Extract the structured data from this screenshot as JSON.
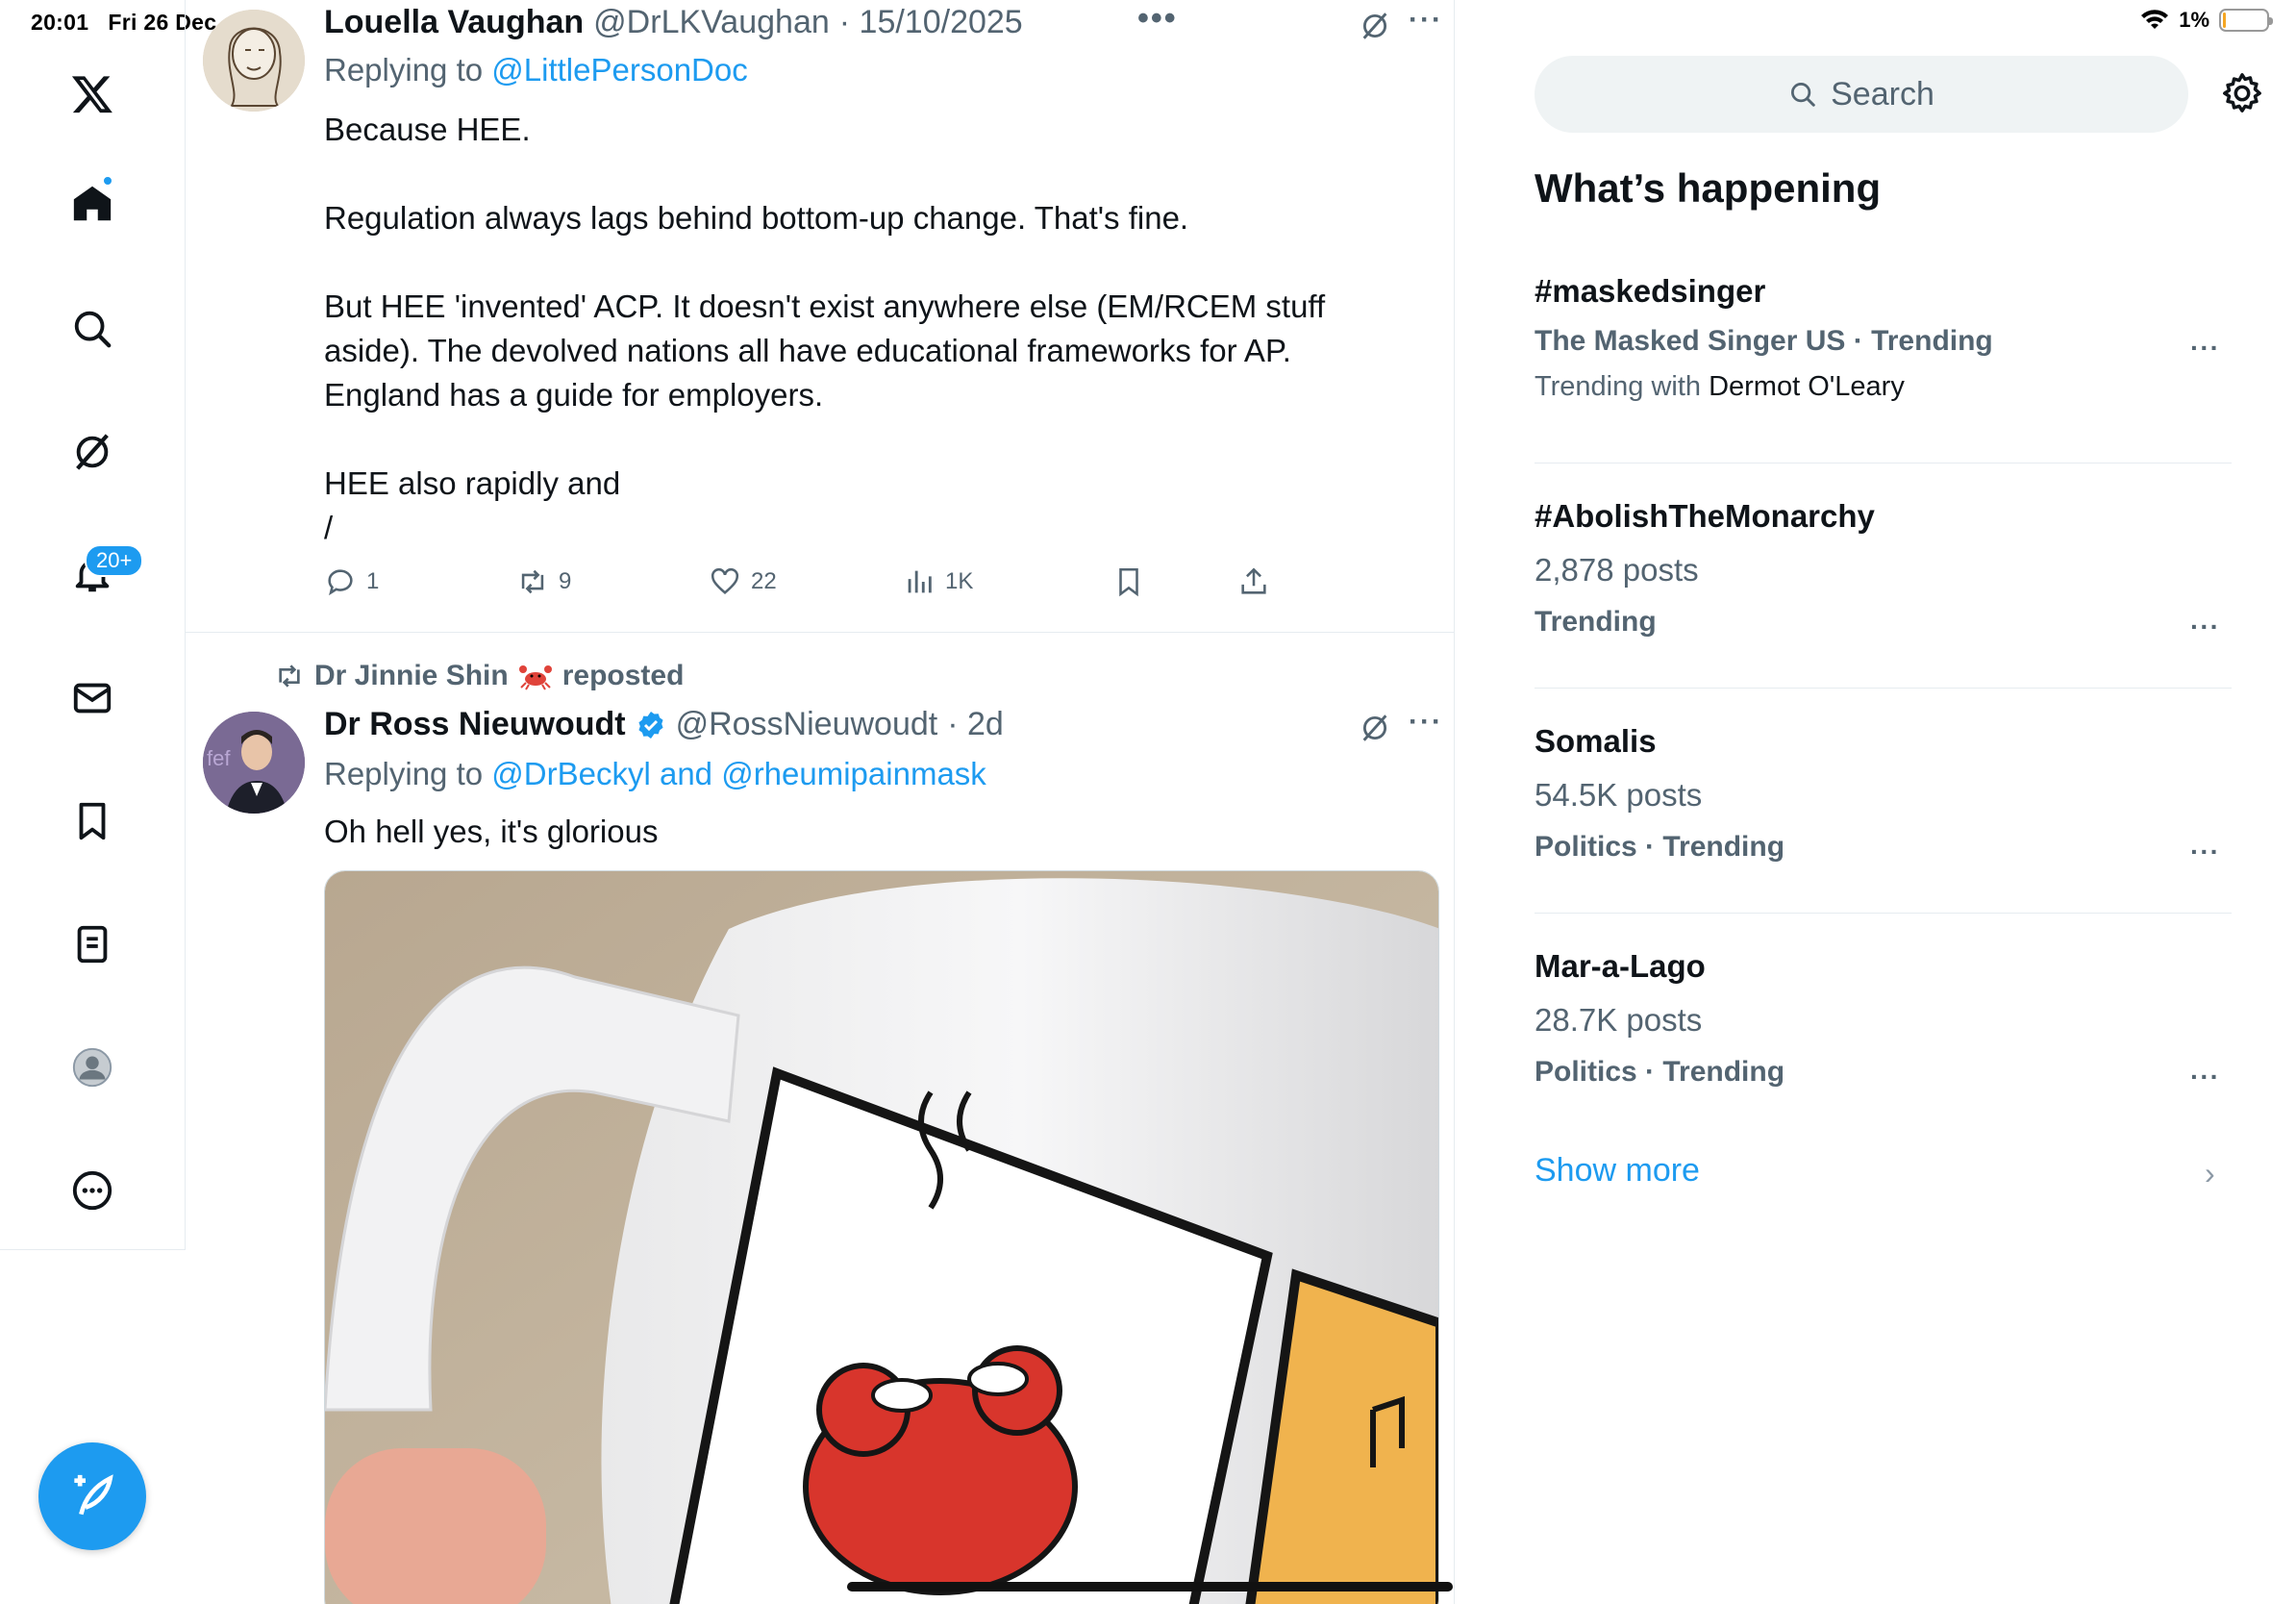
{
  "status_bar": {
    "time": "20:01",
    "date": "Fri 26 Dec",
    "battery": "1%"
  },
  "nav": {
    "notification_badge": "20+",
    "items": [
      "x-logo",
      "home",
      "explore",
      "grok",
      "notifications",
      "messages",
      "bookmarks",
      "lists",
      "profile",
      "more"
    ]
  },
  "tweets": [
    {
      "name": "Louella Vaughan",
      "handle": "@DrLKVaughan",
      "date": "· 15/10/2025",
      "reply_prefix": "Replying to",
      "reply_to": "@LittlePersonDoc",
      "text": "Because HEE.\n\nRegulation always lags behind bottom-up change. That's fine.\n\nBut HEE 'invented' ACP. It doesn't exist anywhere else (EM/RCEM stuff\naside). The devolved nations all have educational frameworks for AP.\nEngland has a guide for employers.\n\nHEE also rapidly and\n/",
      "replies": "1",
      "reposts": "9",
      "likes": "22",
      "views": "1K"
    },
    {
      "reposted_by": "Dr Jinnie Shin",
      "reposted_label": "reposted",
      "name": "Dr Ross Nieuwoudt",
      "handle": "@RossNieuwoudt",
      "date": "· 2d",
      "reply_prefix": "Replying to",
      "reply_to": "@DrBeckyl and @rheumipainmask",
      "text": "Oh hell yes, it's glorious"
    }
  ],
  "sidebar": {
    "search_placeholder": "Search",
    "title": "What’s happening",
    "trends": [
      {
        "title": "#maskedsinger",
        "meta": "The Masked Singer US · Trending",
        "with_prefix": "Trending with",
        "with_name": "Dermot O'Leary"
      },
      {
        "title": "#AbolishTheMonarchy",
        "posts": "2,878 posts",
        "meta": "Trending"
      },
      {
        "title": "Somalis",
        "posts": "54.5K posts",
        "meta": "Politics · Trending"
      },
      {
        "title": "Mar-a-Lago",
        "posts": "28.7K posts",
        "meta": "Politics · Trending"
      }
    ],
    "show_more": "Show more"
  },
  "colors": {
    "accent": "#1d9bf0",
    "text": "#0f1419",
    "muted": "#536471",
    "border": "#e6ecf0"
  }
}
